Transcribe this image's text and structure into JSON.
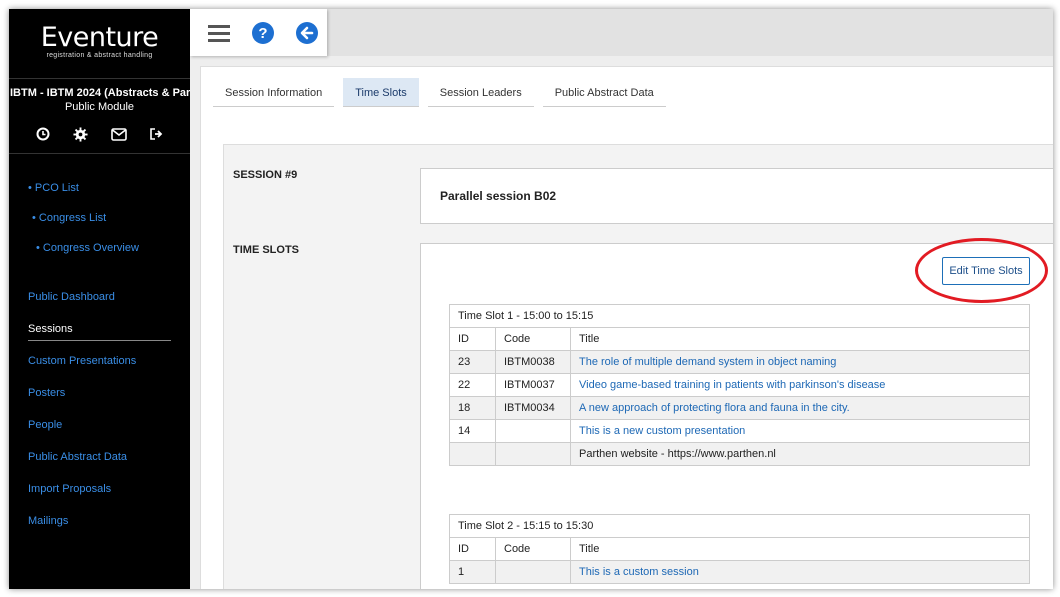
{
  "brand": {
    "logo": "Eventure",
    "tagline": "registration & abstract handling"
  },
  "congress": {
    "title": "IBTM - IBTM 2024 (Abstracts & Par…",
    "module": "Public Module"
  },
  "sidebar": {
    "icons": [
      "clock-icon",
      "gear-icon",
      "mail-icon",
      "logout-icon"
    ],
    "top_items": [
      {
        "label": "• PCO List"
      },
      {
        "label": "• Congress List"
      },
      {
        "label": "• Congress Overview"
      }
    ],
    "main_items": [
      {
        "label": "Public Dashboard"
      },
      {
        "label": "Sessions"
      },
      {
        "label": "Custom Presentations"
      },
      {
        "label": "Posters"
      },
      {
        "label": "People"
      },
      {
        "label": "Public Abstract Data"
      },
      {
        "label": "Import Proposals"
      },
      {
        "label": "Mailings"
      }
    ]
  },
  "toolbar": {
    "icons": [
      "menu-icon",
      "help-icon",
      "back-icon"
    ],
    "accent": "#1d6fd1"
  },
  "tabs": [
    {
      "label": "Session Information"
    },
    {
      "label": "Time Slots",
      "active": true
    },
    {
      "label": "Session Leaders"
    },
    {
      "label": "Public Abstract Data"
    }
  ],
  "session": {
    "label": "SESSION #9",
    "name": "Parallel session B02"
  },
  "timeslots": {
    "label": "TIME SLOTS",
    "edit_label": "Edit Time Slots",
    "highlight_color": "#e21b23",
    "headers": {
      "id": "ID",
      "code": "Code",
      "title": "Title"
    },
    "slots": [
      {
        "caption": "Time Slot 1 - 15:00 to 15:15",
        "rows": [
          {
            "id": "23",
            "code": "IBTM0038",
            "title": "The role of multiple demand system in object naming"
          },
          {
            "id": "22",
            "code": "IBTM0037",
            "title": "Video game-based training in patients with parkinson's disease"
          },
          {
            "id": "18",
            "code": "IBTM0034",
            "title": "A new approach of protecting flora and fauna in the city."
          },
          {
            "id": "14",
            "code": "",
            "title": "This is a new custom presentation"
          }
        ],
        "note": "Parthen website - https://www.parthen.nl"
      },
      {
        "caption": "Time Slot 2 - 15:15 to 15:30",
        "rows": [
          {
            "id": "1",
            "code": "",
            "title": "This is a custom session"
          }
        ]
      }
    ]
  }
}
